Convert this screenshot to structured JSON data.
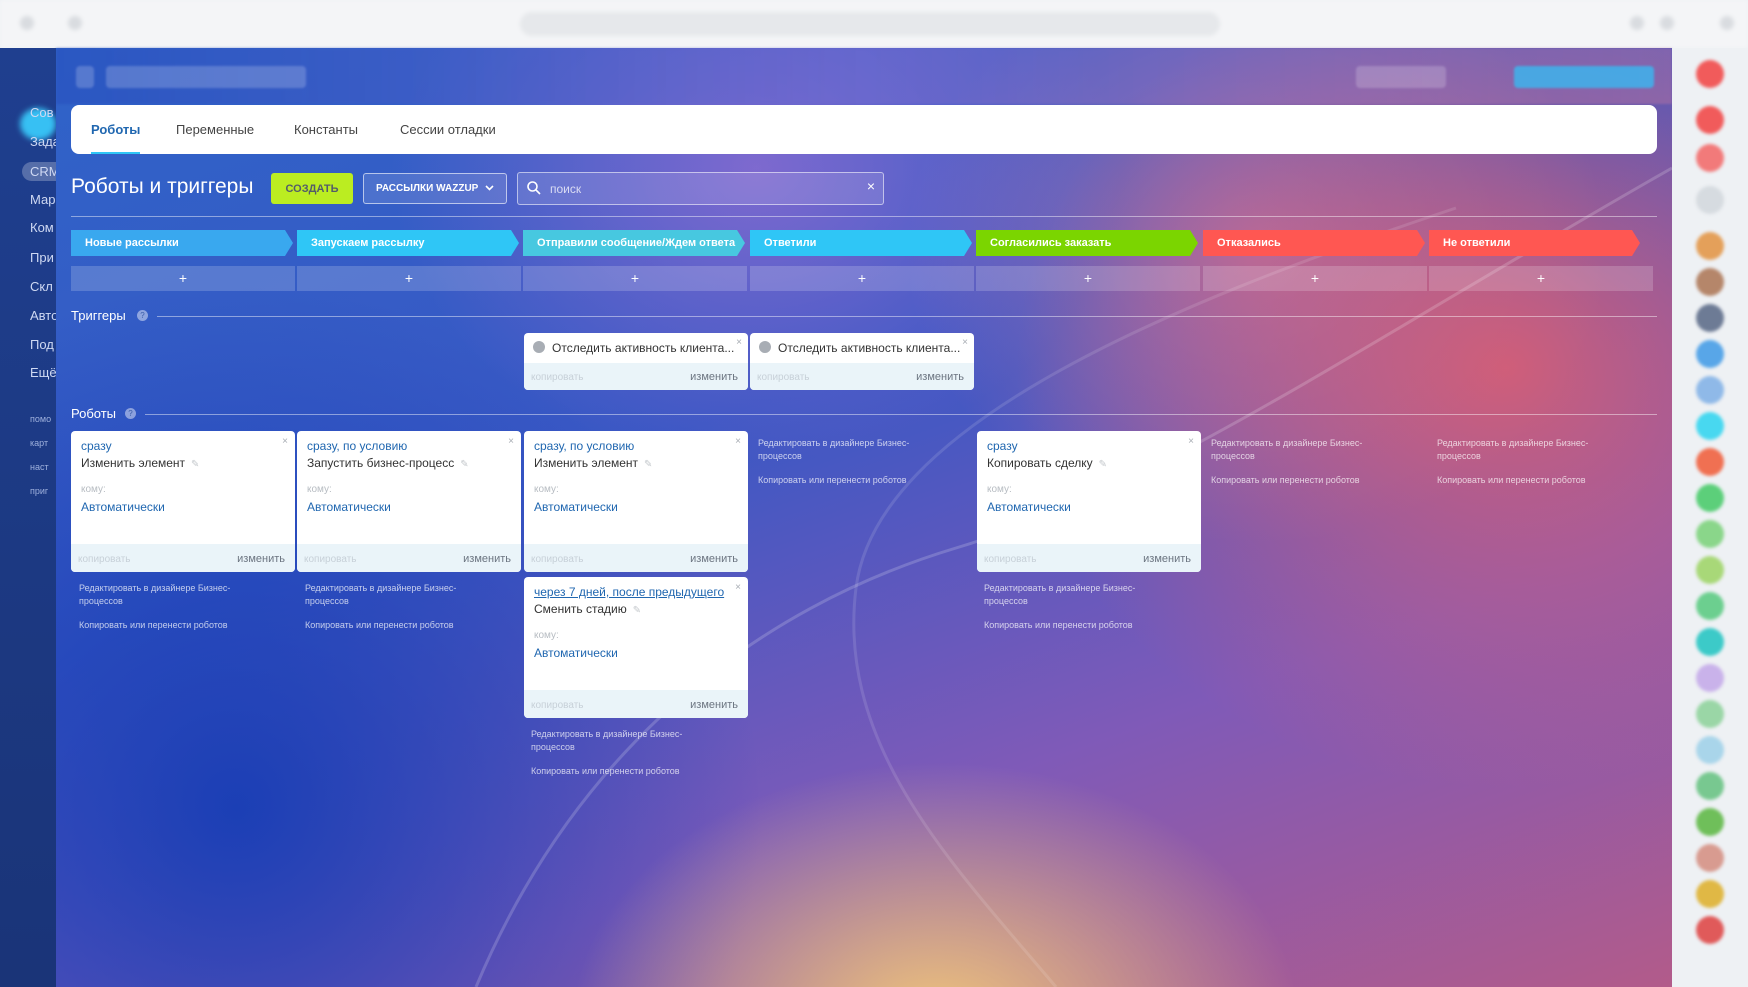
{
  "tabs": [
    {
      "label": "Роботы"
    },
    {
      "label": "Переменные"
    },
    {
      "label": "Константы"
    },
    {
      "label": "Сессии отладки"
    }
  ],
  "toolbar": {
    "title": "Роботы и триггеры",
    "create_label": "СОЗДАТЬ",
    "dropdown_label": "РАССЫЛКИ WAZZUP",
    "search_placeholder": "поиск"
  },
  "sidebar": {
    "items": [
      "Сов",
      "Зада",
      "CRM",
      "Мар",
      "Ком",
      "При",
      "Скл",
      "Авто",
      "Под",
      "Ещё"
    ],
    "small_items": [
      "помо",
      "карт",
      "наст",
      "приг"
    ]
  },
  "stages": [
    {
      "label": "Новые рассылки",
      "color": "#39a8ef"
    },
    {
      "label": "Запускаем рассылку",
      "color": "#2fc6f6"
    },
    {
      "label": "Отправили сообщение/Ждем ответа",
      "color": "#47c8e0"
    },
    {
      "label": "Ответили",
      "color": "#2fc6f6"
    },
    {
      "label": "Согласились заказать",
      "color": "#7bd500"
    },
    {
      "label": "Отказались",
      "color": "#ff5752"
    },
    {
      "label": "Не ответили",
      "color": "#ff5752"
    }
  ],
  "add_symbol": "+",
  "sections": {
    "triggers": "Триггеры",
    "robots": "Роботы",
    "help": "?"
  },
  "triggers": [
    {
      "title": "Отследить активность клиента..."
    },
    {
      "title": "Отследить активность клиента..."
    }
  ],
  "labels": {
    "copy": "копировать",
    "edit": "изменить",
    "who": "кому:",
    "close": "×",
    "edit_in_designer": "Редактировать в дизайнере Бизнес-процессов",
    "copy_move_robots": "Копировать или перенести роботов"
  },
  "robots": [
    {
      "when": "сразу",
      "name": "Изменить элемент",
      "who": "Автоматически"
    },
    {
      "when": "сразу, по условию",
      "name": "Запустить бизнес-процесс",
      "who": "Автоматически"
    },
    {
      "when": "сразу, по условию",
      "name": "Изменить элемент",
      "who": "Автоматически"
    },
    {
      "when": "через 7 дней, после предыдущего",
      "name": "Сменить стадию",
      "who": "Автоматически"
    },
    {
      "when": "сразу",
      "name": "Копировать сделку",
      "who": "Автоматически"
    }
  ]
}
